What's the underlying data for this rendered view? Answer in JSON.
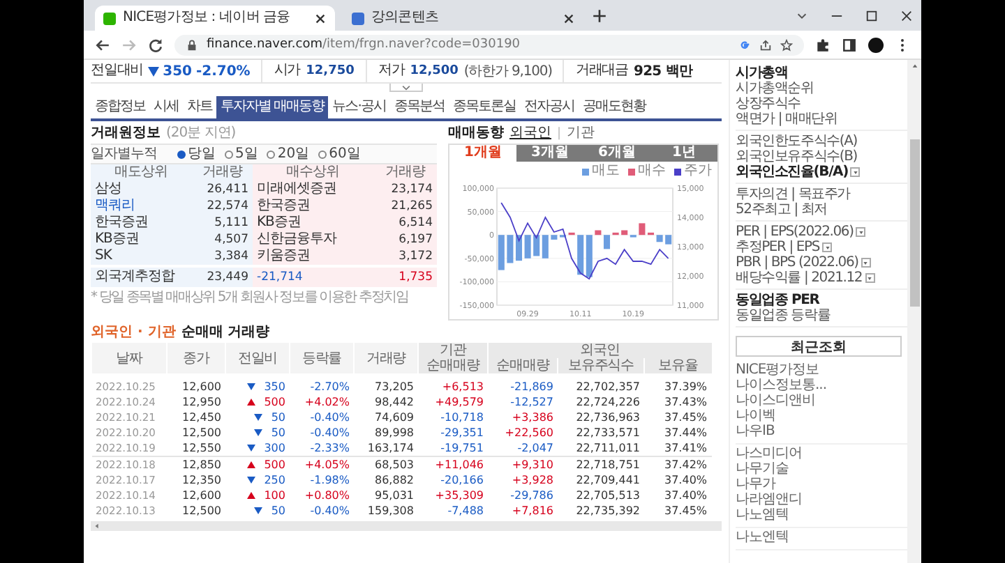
{
  "browser": {
    "tabs": [
      {
        "title": "NICE평가정보 : 네이버 금융",
        "selected": true
      },
      {
        "title": "강의콘텐츠",
        "selected": false
      }
    ],
    "url_host": "finance.naver.com",
    "url_path": "/item/frgn.naver?code=030190"
  },
  "quote": {
    "change_label": "전일대비",
    "falling": true,
    "change": "350",
    "change_rate": "-2.70%",
    "stats": [
      {
        "label": "시가",
        "value": "12,750"
      },
      {
        "label": "저가",
        "value": "12,500",
        "note": "(하한가 9,100)"
      },
      {
        "label": "거래대금",
        "value": "925 백만"
      }
    ]
  },
  "nav_tabs": [
    {
      "label": "종합정보",
      "selected": false
    },
    {
      "label": "시세",
      "selected": false
    },
    {
      "label": "차트",
      "selected": false
    },
    {
      "label": "투자자별 매매동향",
      "selected": true
    },
    {
      "label": "뉴스·공시",
      "selected": false
    },
    {
      "label": "종목분석",
      "selected": false
    },
    {
      "label": "종목토론실",
      "selected": false
    },
    {
      "label": "전자공시",
      "selected": false
    },
    {
      "label": "공매도현황",
      "selected": false
    }
  ],
  "broker": {
    "title": "거래원정보",
    "delay": "(20분 지연)",
    "period_label": "일자별누적",
    "periods": [
      {
        "label": "당일",
        "selected": true
      },
      {
        "label": "5일",
        "selected": false
      },
      {
        "label": "20일",
        "selected": false
      },
      {
        "label": "60일",
        "selected": false
      }
    ],
    "columns": [
      "매도상위",
      "거래량",
      "매수상위",
      "거래량"
    ],
    "rows": [
      {
        "sell": "삼성",
        "sell_volume": "26,411",
        "sell_foreign": false,
        "buy": "미래에셋증권",
        "buy_volume": "23,174",
        "buy_foreign": false
      },
      {
        "sell": "맥쿼리",
        "sell_volume": "22,574",
        "sell_foreign": true,
        "buy": "한국증권",
        "buy_volume": "21,265",
        "buy_foreign": false
      },
      {
        "sell": "한국증권",
        "sell_volume": "5,111",
        "sell_foreign": false,
        "buy": "KB증권",
        "buy_volume": "6,514",
        "buy_foreign": false
      },
      {
        "sell": "KB증권",
        "sell_volume": "4,507",
        "sell_foreign": false,
        "buy": "신한금융투자",
        "buy_volume": "6,197",
        "buy_foreign": false
      },
      {
        "sell": "SK",
        "sell_volume": "3,384",
        "sell_foreign": false,
        "buy": "키움증권",
        "buy_volume": "3,172",
        "buy_foreign": false
      }
    ],
    "total": {
      "label": "외국계추정합",
      "sell_volume": "23,449",
      "net": "-21,714",
      "buy_volume": "1,735"
    },
    "note": "* 당일 종목별 매매상위 5개 회원사 정보를 이용한 추정치임"
  },
  "trend": {
    "title": "매매동향",
    "separator": "|",
    "investors": [
      {
        "label": "외국인",
        "selected": true
      },
      {
        "label": "기관",
        "selected": false
      }
    ],
    "periods": [
      {
        "label": "1개월",
        "selected": true
      },
      {
        "label": "3개월",
        "selected": false
      },
      {
        "label": "6개월",
        "selected": false
      },
      {
        "label": "1년",
        "selected": false
      }
    ],
    "chart_data": {
      "type": "bar",
      "categories": [
        null,
        null,
        null,
        "09.29",
        null,
        null,
        null,
        null,
        null,
        "10.11",
        null,
        null,
        null,
        null,
        null,
        "10.19",
        null,
        null,
        null,
        null
      ],
      "series": [
        {
          "name": "매도",
          "color": "#6c9ee0",
          "values": [
            -75000,
            -60000,
            -55000,
            -50000,
            -45000,
            -50000,
            -10000,
            -5000,
            null,
            -85000,
            -90000,
            null,
            -30000,
            null,
            null,
            -5000,
            null,
            null,
            -15000,
            -20000
          ]
        },
        {
          "name": "매수",
          "color": "#e05c78",
          "values": [
            null,
            null,
            null,
            null,
            null,
            null,
            null,
            null,
            5000,
            null,
            null,
            10000,
            null,
            5000,
            10000,
            null,
            25000,
            5000,
            null,
            null
          ]
        },
        {
          "name": "주가",
          "type": "line",
          "axis": "y2",
          "color": "#4b3fc8",
          "values": [
            14500,
            14000,
            13200,
            13800,
            13300,
            14000,
            13500,
            13600,
            12600,
            12100,
            11900,
            12500,
            12600,
            12400,
            12900,
            12500,
            12500,
            12400,
            12900,
            12600
          ]
        }
      ],
      "grid": true,
      "ylim": [
        -150000,
        100000
      ],
      "y2lim": [
        11000,
        15000
      ],
      "yticks": [
        {
          "value": 100000,
          "label": "100,000"
        },
        {
          "value": 50000,
          "label": "50,000"
        },
        {
          "value": 0,
          "label": "0"
        },
        {
          "value": -50000,
          "label": "-50,000"
        },
        {
          "value": -100000,
          "label": "-100,000"
        },
        {
          "value": -150000,
          "label": "-150,000"
        }
      ],
      "y2ticks": [
        {
          "value": 15000,
          "label": "15,000"
        },
        {
          "value": 14000,
          "label": "14,000"
        },
        {
          "value": 13000,
          "label": "13,000"
        },
        {
          "value": 12000,
          "label": "12,000"
        },
        {
          "value": 11000,
          "label": "11,000"
        }
      ]
    }
  },
  "net": {
    "title_highlight": "외국인 · 기관",
    "title_rest": "순매매 거래량",
    "columns": [
      "날짜",
      "종가",
      "전일비",
      "등락률",
      "거래량"
    ],
    "groups": [
      {
        "label": "기관",
        "columns": [
          "순매매량"
        ]
      },
      {
        "label": "외국인",
        "columns": [
          "순매매량",
          "보유주식수",
          "보유율"
        ]
      }
    ],
    "row_groups": [
      [
        {
          "date": "2022.10.25",
          "close": "12,600",
          "rising": false,
          "change": "350",
          "rate": "-2.70%",
          "volume": "73,205",
          "inst": "+6,513",
          "inst_up": true,
          "frgn": "-21,869",
          "frgn_up": false,
          "holdings": "22,702,357",
          "ratio": "37.39%"
        },
        {
          "date": "2022.10.24",
          "close": "12,950",
          "rising": true,
          "change": "500",
          "rate": "+4.02%",
          "volume": "98,442",
          "inst": "+49,579",
          "inst_up": true,
          "frgn": "-12,527",
          "frgn_up": false,
          "holdings": "22,724,226",
          "ratio": "37.43%"
        },
        {
          "date": "2022.10.21",
          "close": "12,450",
          "rising": false,
          "change": "50",
          "rate": "-0.40%",
          "volume": "74,609",
          "inst": "-10,718",
          "inst_up": false,
          "frgn": "+3,386",
          "frgn_up": true,
          "holdings": "22,736,963",
          "ratio": "37.45%"
        },
        {
          "date": "2022.10.20",
          "close": "12,500",
          "rising": false,
          "change": "50",
          "rate": "-0.40%",
          "volume": "89,998",
          "inst": "-29,351",
          "inst_up": false,
          "frgn": "+22,560",
          "frgn_up": true,
          "holdings": "22,733,571",
          "ratio": "37.44%"
        },
        {
          "date": "2022.10.19",
          "close": "12,550",
          "rising": false,
          "change": "300",
          "rate": "-2.33%",
          "volume": "163,174",
          "inst": "-19,751",
          "inst_up": false,
          "frgn": "-2,047",
          "frgn_up": false,
          "holdings": "22,711,011",
          "ratio": "37.41%"
        }
      ],
      [
        {
          "date": "2022.10.18",
          "close": "12,850",
          "rising": true,
          "change": "500",
          "rate": "+4.05%",
          "volume": "68,503",
          "inst": "+11,046",
          "inst_up": true,
          "frgn": "+9,310",
          "frgn_up": true,
          "holdings": "22,718,751",
          "ratio": "37.42%"
        },
        {
          "date": "2022.10.17",
          "close": "12,350",
          "rising": false,
          "change": "250",
          "rate": "-1.98%",
          "volume": "86,882",
          "inst": "-20,166",
          "inst_up": false,
          "frgn": "+3,928",
          "frgn_up": true,
          "holdings": "22,709,441",
          "ratio": "37.40%"
        },
        {
          "date": "2022.10.14",
          "close": "12,600",
          "rising": true,
          "change": "100",
          "rate": "+0.80%",
          "volume": "95,031",
          "inst": "+35,309",
          "inst_up": true,
          "frgn": "-29,786",
          "frgn_up": false,
          "holdings": "22,705,513",
          "ratio": "37.40%"
        },
        {
          "date": "2022.10.13",
          "close": "12,500",
          "rising": false,
          "change": "50",
          "rate": "-0.40%",
          "volume": "159,308",
          "inst": "-7,488",
          "inst_up": false,
          "frgn": "+7,816",
          "frgn_up": true,
          "holdings": "22,735,392",
          "ratio": "37.45%"
        }
      ]
    ]
  },
  "sidebar": {
    "groups": [
      [
        {
          "label": "시가총액",
          "bold": true,
          "help": false
        },
        {
          "label": "시가총액순위",
          "bold": false,
          "help": false
        },
        {
          "label": "상장주식수",
          "bold": false,
          "help": false
        },
        {
          "label": "액면가 | 매매단위",
          "bold": false,
          "help": false
        }
      ],
      [
        {
          "label": "외국인한도주식수(A)",
          "bold": false,
          "help": false
        },
        {
          "label": "외국인보유주식수(B)",
          "bold": false,
          "help": false
        },
        {
          "label": "외국인소진율(B/A)",
          "bold": true,
          "help": true
        }
      ],
      [
        {
          "label": "투자의견 | 목표주가",
          "bold": false,
          "help": false
        },
        {
          "label": "52주최고 | 최저",
          "bold": false,
          "help": false
        }
      ],
      [
        {
          "label": "PER | EPS(2022.06)",
          "bold": false,
          "help": true
        },
        {
          "label": "추정PER | EPS",
          "bold": false,
          "help": true
        },
        {
          "label": "PBR | BPS (2022.06)",
          "bold": false,
          "help": true
        },
        {
          "label": "배당수익률 | 2021.12",
          "bold": false,
          "help": true
        }
      ],
      [
        {
          "label": "동일업종 PER",
          "bold": true,
          "help": false
        },
        {
          "label": "동일업종 등락률",
          "bold": false,
          "help": false
        }
      ]
    ],
    "recent_button": "최근조회",
    "recent": [
      [
        "NICE평가정보",
        "나이스정보통...",
        "나이스디앤비",
        "나이벡",
        "나우IB"
      ],
      [
        "나스미디어",
        "나무기술",
        "나무가",
        "나라엠앤디",
        "나노엠텍"
      ],
      [
        "나노엔텍"
      ]
    ]
  }
}
